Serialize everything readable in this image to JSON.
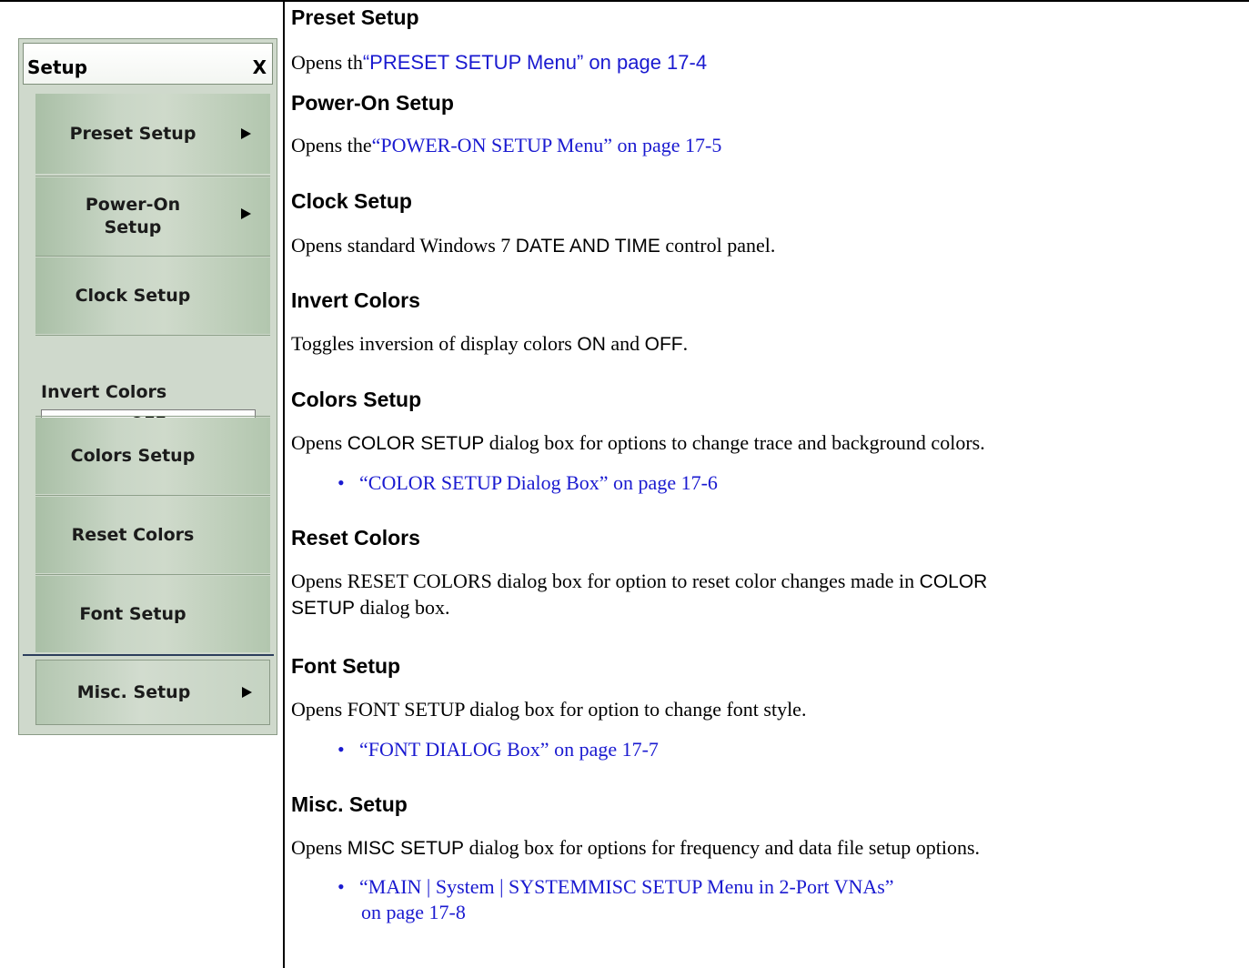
{
  "menu": {
    "title": "Setup",
    "close_label": "X",
    "preset_setup": "Preset Setup",
    "power_on_setup_l1": "Power-On",
    "power_on_setup_l2": "Setup",
    "clock_setup": "Clock Setup",
    "invert_colors_label": "Invert Colors",
    "invert_colors_value": "OFF",
    "colors_setup": "Colors Setup",
    "reset_colors": "Reset Colors",
    "font_setup": "Font Setup",
    "misc_setup": "Misc. Setup"
  },
  "doc": {
    "preset": {
      "heading": "Preset Setup",
      "text": "Opens th",
      "link": "“PRESET SETUP Menu” on page 17-4"
    },
    "power_on": {
      "heading": "Power-On Setup",
      "text": "Opens the",
      "link": "“POWER-ON SETUP Menu” on page 17-5"
    },
    "clock": {
      "heading": "Clock Setup",
      "text_a": "Opens standard Windows 7 ",
      "kw": "DATE AND TIME",
      "text_b": " control panel."
    },
    "invert": {
      "heading": "Invert Colors",
      "text_a": "Toggles inversion of display colors ",
      "kw1": "ON",
      "text_b": " and ",
      "kw2": "OFF",
      "text_c": "."
    },
    "colors": {
      "heading": "Colors Setup",
      "text_a": "Opens ",
      "kw": "COLOR SETUP",
      "text_b": " dialog box for options to change trace and background colors.",
      "bullet": "“COLOR SETUP Dialog Box” on page 17-6"
    },
    "reset": {
      "heading": "Reset Colors",
      "line1_a": "Opens RESET COLORS dialog box for option to reset color changes made in ",
      "line1_kw": "COLOR",
      "line2_kw": "SETUP",
      "line2_b": " dialog box."
    },
    "font": {
      "heading": "Font Setup",
      "text": "Opens FONT SETUP dialog box for option to change font style.",
      "bullet": "“FONT DIALOG Box” on page 17-7"
    },
    "misc": {
      "heading": "Misc. Setup",
      "text_a": "Opens ",
      "kw": "MISC SETUP",
      "text_b": " dialog box for options for frequency and data file setup options.",
      "bullet_l1": "“MAIN | System | SYSTEMMISC SETUP Menu in 2-Port VNAs”",
      "bullet_l2": "on page 17-8"
    }
  }
}
